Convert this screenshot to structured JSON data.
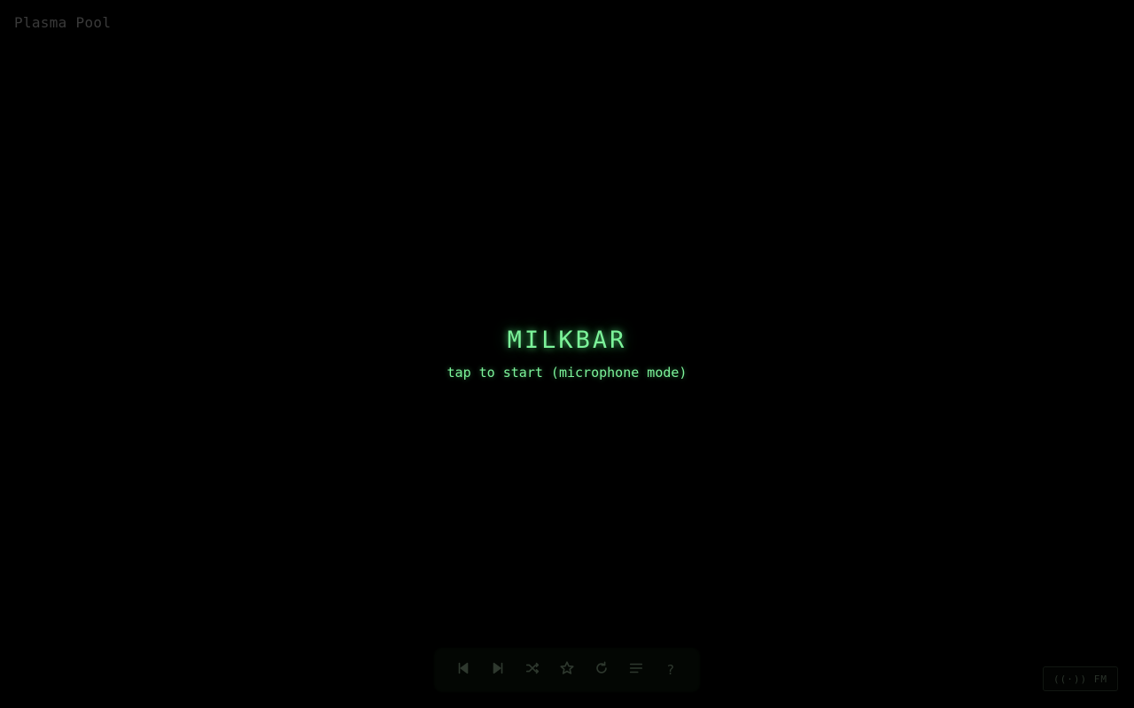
{
  "preset": {
    "name": "Plasma Pool"
  },
  "splash": {
    "title": "MILKBAR",
    "subtitle": "tap to start (microphone mode)"
  },
  "controls": {
    "items": [
      {
        "icon": "skip-previous-icon"
      },
      {
        "icon": "skip-next-icon"
      },
      {
        "icon": "shuffle-icon"
      },
      {
        "icon": "star-icon"
      },
      {
        "icon": "refresh-icon"
      },
      {
        "icon": "list-icon"
      },
      {
        "icon": "help-icon",
        "label": "?"
      }
    ]
  },
  "radio": {
    "label": "((·)) FM"
  },
  "colors": {
    "background": "#000000",
    "accent": "#7cf39a",
    "preset_text": "#3a3a3a",
    "control_icon": "#2e382e"
  }
}
